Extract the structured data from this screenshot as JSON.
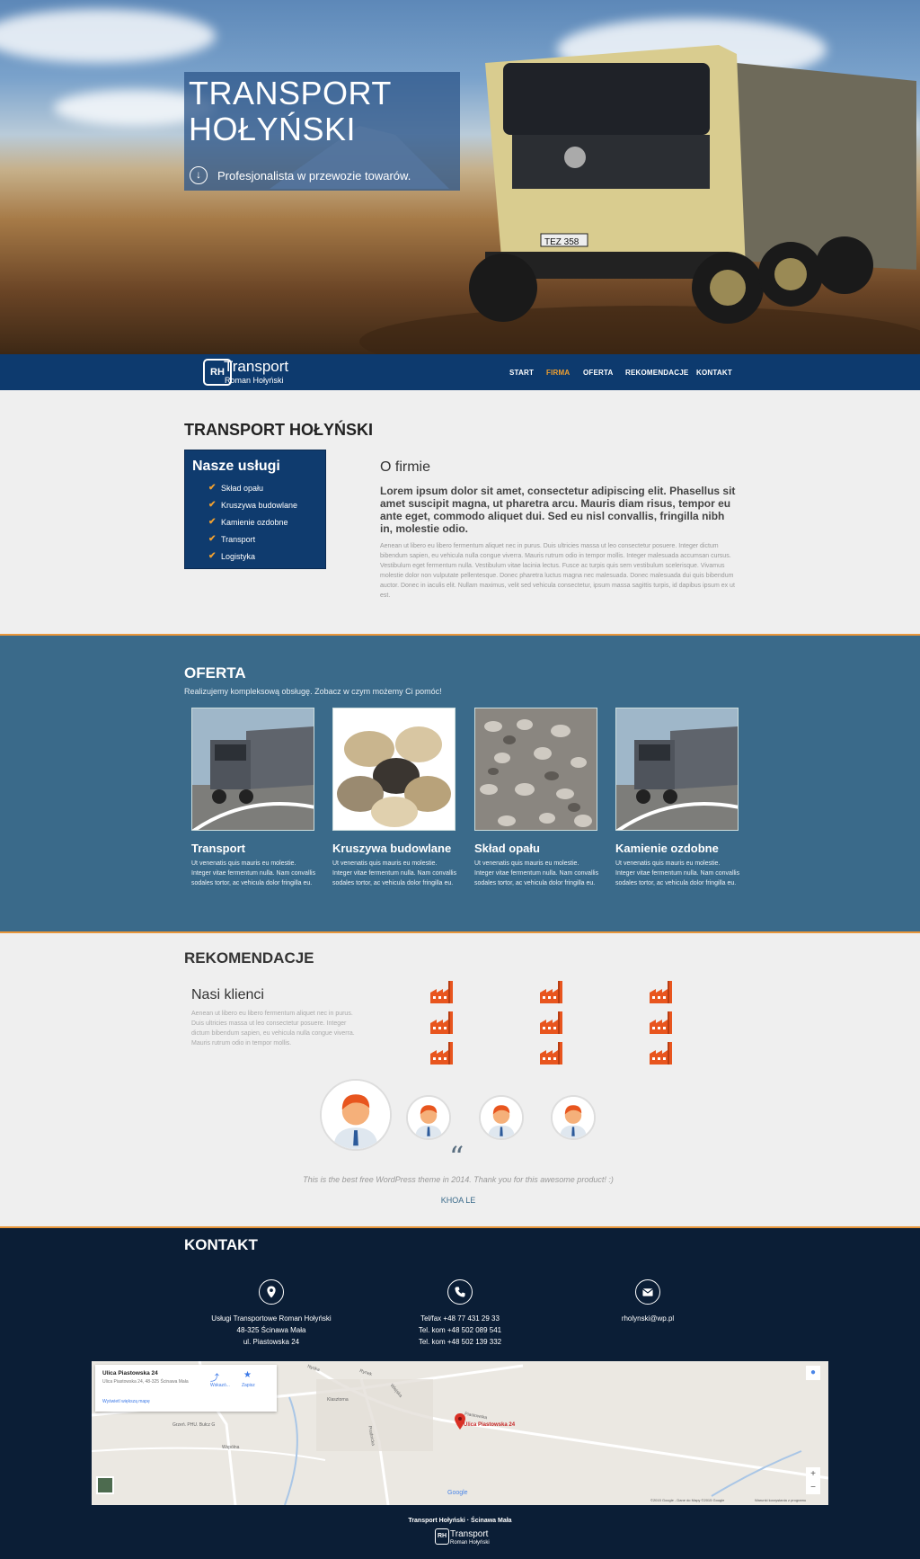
{
  "hero": {
    "title": "TRANSPORT HOŁYŃSKI",
    "subtitle": "Profesjonalista w przewozie towarów.",
    "scroll_icon": "arrow-down-circle-icon"
  },
  "nav": {
    "logo_mark": "RH",
    "logo_title": "Transport",
    "logo_subtitle": "Roman Hołyński",
    "items": [
      "START",
      "FIRMA",
      "OFERTA",
      "REKOMENDACJE",
      "KONTAKT"
    ],
    "active": "FIRMA"
  },
  "firma": {
    "heading": "TRANSPORT HOŁYŃSKI",
    "services_heading": "Nasze usługi",
    "services": [
      "Skład opału",
      "Kruszywa budowlane",
      "Kamienie ozdobne",
      "Transport",
      "Logistyka"
    ],
    "about_heading": "O firmie",
    "lead": "Lorem ipsum dolor sit amet, consectetur adipiscing elit. Phasellus sit amet suscipit magna, ut pharetra arcu. Mauris diam risus, tempor eu ante eget, commodo aliquet dui. Sed eu nisl convallis, fringilla nibh in, molestie odio.",
    "body": "Aenean ut libero eu libero fermentum aliquet nec in purus. Duis ultricies massa ut leo consectetur posuere. Integer dictum bibendum sapien, eu vehicula nulla congue viverra. Mauris rutrum odio in tempor mollis. Integer malesuada accumsan cursus. Vestibulum eget fermentum nulla. Vestibulum vitae lacinia lectus. Fusce ac turpis quis sem vestibulum scelerisque. Vivamus molestie dolor non vulputate pellentesque. Donec pharetra luctus magna nec malesuada. Donec malesuada dui quis bibendum auctor. Donec in iaculis elit. Nullam maximus, velit sed vehicula consectetur, ipsum massa sagittis turpis, id dapibus ipsum ex ut est."
  },
  "oferta": {
    "heading": "OFERTA",
    "subtitle": "Realizujemy kompleksową obsługę. Zobacz w czym możemy Ci pomóc!",
    "items": [
      {
        "title": "Transport",
        "text": "Ut venenatis quis mauris eu molestie. Integer vitae fermentum nulla. Nam convallis sodales tortor, ac vehicula dolor fringilla eu."
      },
      {
        "title": "Kruszywa budowlane",
        "text": "Ut venenatis quis mauris eu molestie. Integer vitae fermentum nulla. Nam convallis sodales tortor, ac vehicula dolor fringilla eu."
      },
      {
        "title": "Skład opału",
        "text": "Ut venenatis quis mauris eu molestie. Integer vitae fermentum nulla. Nam convallis sodales tortor, ac vehicula dolor fringilla eu."
      },
      {
        "title": "Kamienie ozdobne",
        "text": "Ut venenatis quis mauris eu molestie. Integer vitae fermentum nulla. Nam convallis sodales tortor, ac vehicula dolor fringilla eu."
      }
    ]
  },
  "rekomendacje": {
    "heading": "REKOMENDACJE",
    "clients_heading": "Nasi klienci",
    "clients_text": "Aenean ut libero eu libero fermentum aliquet nec in purus. Duis ultricies massa ut leo consectetur posuere. Integer dictum bibendum sapien, eu vehicula nulla congue viverra. Mauris rutrum odio in tempor mollis.",
    "quote_mark": "“",
    "quote": "This is the best free WordPress theme in 2014. Thank you for this awesome product! :)",
    "author": "KHOA LE"
  },
  "kontakt": {
    "heading": "KONTAKT",
    "address_icon": "map-pin-icon",
    "phone_icon": "phone-icon",
    "email_icon": "envelope-icon",
    "address": [
      "Usługi Transportowe Roman Hołyński",
      "48-325 Ścinawa Mała",
      "ul. Piastowska 24"
    ],
    "phones": [
      "Tel/fax +48 77 431 29 33",
      "Tel. kom +48 502 089 541",
      "Tel. kom +48 502 139 332"
    ],
    "email": "rholynski@wp.pl"
  },
  "map": {
    "card_title": "Ulica Piastowska 24",
    "card_address": "Ulica Piastowska 24, 48-325 Ścinawa Mała",
    "card_link": "Wyświetl większą mapę",
    "directions": "Wskazó...",
    "save": "Zapisz",
    "marker_label": "Ulica Piastowska 24",
    "labels": [
      "Nyska",
      "Rynek",
      "Wiejska",
      "Klasztorna",
      "Piastowska",
      "Prudnicka",
      "Wspólna",
      "Grzeń. PHU. Bułcz G"
    ],
    "copyright": "©2015 Google - Dane do Mapy ©2015 Google",
    "terms": "Warunki korzystania z programu",
    "google": "Google"
  },
  "footer": {
    "text": "Transport Hołyński · Ścinawa Mała",
    "logo_mark": "RH",
    "logo_title": "Transport",
    "logo_subtitle": "Roman Hołyński"
  },
  "colors": {
    "nav_bg": "#0d3a6e",
    "accent": "#f0a030",
    "oferta_bg": "#3a6a8a",
    "kontakt_bg": "#0b1e36"
  }
}
